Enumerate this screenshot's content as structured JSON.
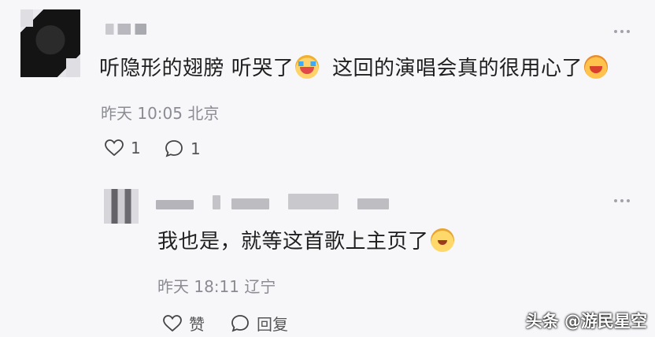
{
  "comment": {
    "text_part1": "听隐形的翅膀 听哭了",
    "text_part2": "这回的演唱会真的很用心了",
    "emoji1": "crying-face-icon",
    "emoji2": "laughing-face-icon",
    "time": "昨天 10:05",
    "location": "北京",
    "likes": "1",
    "replies": "1"
  },
  "reply": {
    "text": "我也是，就等这首歌上主页了",
    "emoji": "smiling-face-icon",
    "time": "昨天 18:11",
    "location": "辽宁",
    "like_label": "赞",
    "reply_label": "回复"
  },
  "watermark": {
    "text": "头条 @游民星空"
  },
  "colors": {
    "background": "#f7f7fa",
    "meta_text": "#8b8b92",
    "primary_text": "#1f1f1f"
  }
}
